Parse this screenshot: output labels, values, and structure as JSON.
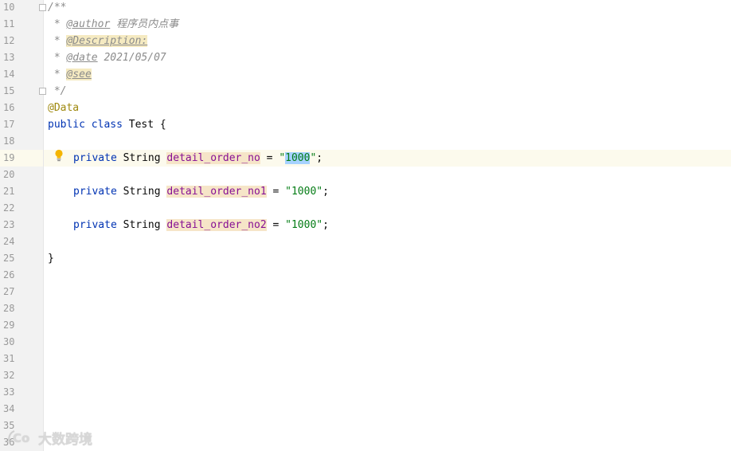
{
  "editor": {
    "current_line_number": "19",
    "lines": [
      {
        "n": "10",
        "text": "/**"
      },
      {
        "n": "11",
        "prefix": " * ",
        "tag": "@author",
        "rest": " 程序员内点事"
      },
      {
        "n": "12",
        "prefix": " * ",
        "tag": "@Description:",
        "rest": ""
      },
      {
        "n": "13",
        "prefix": " * ",
        "tag": "@date",
        "rest": " 2021/05/07"
      },
      {
        "n": "14",
        "prefix": " * ",
        "tag": "@see",
        "rest": ""
      },
      {
        "n": "15",
        "text": " */"
      },
      {
        "n": "16",
        "text": "@Data"
      },
      {
        "n": "17",
        "kw1": "public",
        "kw2": "class",
        "name": "Test",
        "brace": "{"
      },
      {
        "n": "18"
      },
      {
        "n": "19",
        "kw": "private",
        "type": "String",
        "field": "detail_order_no",
        "eq": "=",
        "q1": "\"",
        "value": "1000",
        "q2": "\"",
        "semi": ";"
      },
      {
        "n": "20"
      },
      {
        "n": "21",
        "kw": "private",
        "type": "String",
        "field": "detail_order_no1",
        "eq": "=",
        "str": "\"1000\"",
        "semi": ";"
      },
      {
        "n": "22"
      },
      {
        "n": "23",
        "kw": "private",
        "type": "String",
        "field": "detail_order_no2",
        "eq": "=",
        "str": "\"1000\"",
        "semi": ";"
      },
      {
        "n": "24"
      },
      {
        "n": "25",
        "text": "}"
      },
      {
        "n": "26"
      },
      {
        "n": "27"
      },
      {
        "n": "28"
      },
      {
        "n": "29"
      },
      {
        "n": "30"
      },
      {
        "n": "31"
      },
      {
        "n": "32"
      },
      {
        "n": "33"
      },
      {
        "n": "34"
      },
      {
        "n": "35"
      },
      {
        "n": "36"
      }
    ]
  },
  "watermark": {
    "text": "大数跨境",
    "icon": "brand-logo-icon"
  },
  "colors": {
    "keyword": "#0033b3",
    "field": "#871094",
    "string": "#067d17",
    "annotation": "#9e880d",
    "comment": "#8c8c8c",
    "current_line": "#fcfaed",
    "selection": "#a6d2ff"
  }
}
